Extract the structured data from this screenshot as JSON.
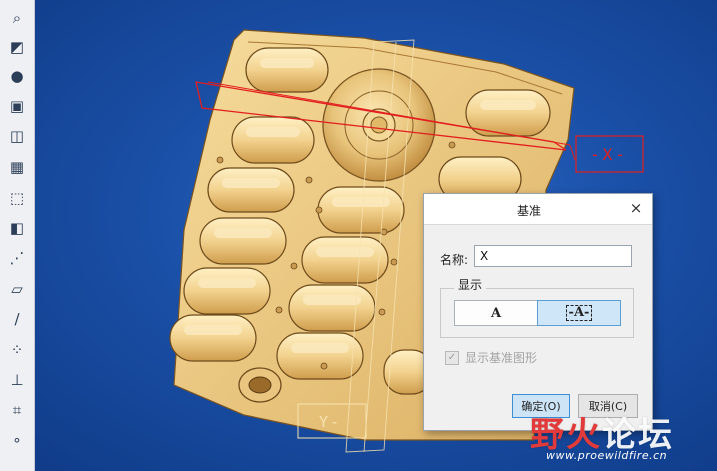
{
  "toolbar": {
    "tools": [
      {
        "name": "zoom-tool-icon",
        "glyph": "⌕"
      },
      {
        "name": "sketch-plane-icon",
        "glyph": "◩"
      },
      {
        "name": "shading-icon",
        "glyph": "●"
      },
      {
        "name": "extrude-icon",
        "glyph": "▣"
      },
      {
        "name": "datum-plane-icon",
        "glyph": "◫"
      },
      {
        "name": "saved-view-icon",
        "glyph": "▦"
      },
      {
        "name": "insert-feature-icon",
        "glyph": "⬚"
      },
      {
        "name": "solid-view-icon",
        "glyph": "◧"
      },
      {
        "name": "datum-axis-display-icon",
        "glyph": "⋰"
      },
      {
        "name": "plane-display-icon",
        "glyph": "▱"
      },
      {
        "name": "axis-display-icon",
        "glyph": "∕"
      },
      {
        "name": "point-display-icon",
        "glyph": "⁘"
      },
      {
        "name": "csys-display-icon",
        "glyph": "⊥"
      },
      {
        "name": "annotation-display-icon",
        "glyph": "⌗"
      },
      {
        "name": "spin-center-icon",
        "glyph": "∘"
      }
    ]
  },
  "viewport": {
    "datum_tag_x": "-X-",
    "datum_tag_y": "Y-"
  },
  "dialog": {
    "title": "基准",
    "close_glyph": "×",
    "name_label": "名称:",
    "name_value": "X",
    "display_group_label": "显示",
    "option_a": "A",
    "option_a_dash": "-A-",
    "show_datum_label": "显示基准图形",
    "show_datum_checked": true,
    "ok_label": "确定(O)",
    "cancel_label": "取消(C)"
  },
  "watermark": {
    "part1": "野火",
    "part2": "论坛",
    "url": "www.proewildfire.cn"
  },
  "colors": {
    "background": "#1a4fa6",
    "part": "#f0cf8a",
    "datum_red": "#e31e1e",
    "selected_option": "#cfe6f8"
  }
}
